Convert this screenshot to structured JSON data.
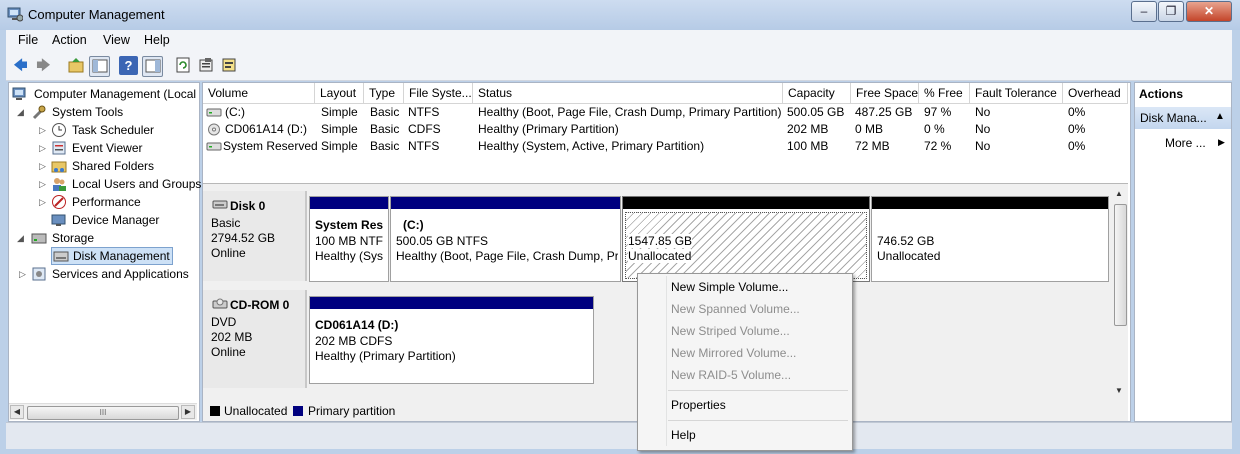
{
  "window": {
    "title": "Computer Management",
    "buttons": [
      "‒",
      "❐",
      "✕"
    ]
  },
  "menu": [
    "File",
    "Action",
    "View",
    "Help"
  ],
  "tree": {
    "root": "Computer Management (Local",
    "system_tools": "System Tools",
    "task_scheduler": "Task Scheduler",
    "event_viewer": "Event Viewer",
    "shared_folders": "Shared Folders",
    "local_users": "Local Users and Groups",
    "performance": "Performance",
    "device_manager": "Device Manager",
    "storage": "Storage",
    "disk_management": "Disk Management",
    "services": "Services and Applications",
    "hscroll_grip": "III"
  },
  "volumes": {
    "headers": [
      "Volume",
      "Layout",
      "Type",
      "File Syste...",
      "Status",
      "Capacity",
      "Free Space",
      "% Free",
      "Fault Tolerance",
      "Overhead"
    ],
    "rows": [
      [
        "(C:)",
        "Simple",
        "Basic",
        "NTFS",
        "Healthy (Boot, Page File, Crash Dump, Primary Partition)",
        "500.05 GB",
        "487.25 GB",
        "97 %",
        "No",
        "0%"
      ],
      [
        "CD061A14 (D:)",
        "Simple",
        "Basic",
        "CDFS",
        "Healthy (Primary Partition)",
        "202 MB",
        "0 MB",
        "0 %",
        "No",
        "0%"
      ],
      [
        "System Reserved",
        "Simple",
        "Basic",
        "NTFS",
        "Healthy (System, Active, Primary Partition)",
        "100 MB",
        "72 MB",
        "72 %",
        "No",
        "0%"
      ]
    ]
  },
  "disk0": {
    "name": "Disk 0",
    "type": "Basic",
    "size": "2794.52 GB",
    "state": "Online",
    "p1": {
      "title": "System Res",
      "line2": "100 MB NTF",
      "line3": "Healthy (Sys"
    },
    "p2": {
      "title": "(C:)",
      "line2": "500.05 GB NTFS",
      "line3": "Healthy (Boot, Page File, Crash Dump, Pr"
    },
    "p3": {
      "line1": "1547.85 GB",
      "line2": "Unallocated"
    },
    "p4": {
      "line1": "746.52 GB",
      "line2": "Unallocated"
    }
  },
  "cdrom0": {
    "name": "CD-ROM 0",
    "type": "DVD",
    "size": "202 MB",
    "state": "Online",
    "p1": {
      "title": "CD061A14  (D:)",
      "line2": "202 MB CDFS",
      "line3": "Healthy (Primary Partition)"
    }
  },
  "legend": {
    "unallocated": "Unallocated",
    "primary": "Primary partition"
  },
  "actions": {
    "header": "Actions",
    "section": "Disk Mana...",
    "more": "More ..."
  },
  "context_menu": {
    "new_simple": "New Simple Volume...",
    "new_spanned": "New Spanned Volume...",
    "new_striped": "New Striped Volume...",
    "new_mirrored": "New Mirrored Volume...",
    "new_raid5": "New RAID-5 Volume...",
    "properties": "Properties",
    "help": "Help"
  },
  "colors": {
    "primary_partition": "#00007f",
    "unallocated": "#000000",
    "selection": "#cde1f6"
  }
}
